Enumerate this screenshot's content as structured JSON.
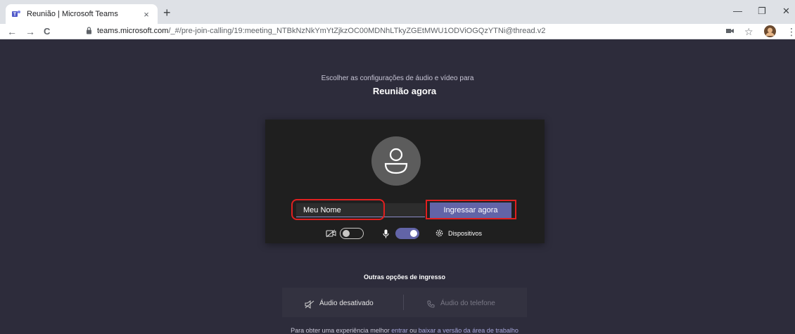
{
  "browser": {
    "tab_title": "Reunião | Microsoft Teams",
    "tab_close": "×",
    "new_tab": "+",
    "url_host": "teams.microsoft.com",
    "url_path": "/_#/pre-join-calling/19:meeting_NTBkNzNkYmYtZjkzOC00MDNhLTkyZGEtMWU1ODViOGQzYTNi@thread.v2",
    "back": "←",
    "forward": "→",
    "reload": "C",
    "minimize": "—",
    "restore": "❐",
    "close": "✕",
    "bookmark_star": "☆",
    "menu": "⋮"
  },
  "prejoin": {
    "subtitle": "Escolher as configurações de áudio e vídeo para",
    "meeting_title": "Reunião agora",
    "name_value": "Meu Nome",
    "join_label": "Ingressar agora",
    "devices_label": "Dispositivos",
    "camera_on": false,
    "mic_on": true
  },
  "other_options": {
    "title": "Outras opções de ingresso",
    "audio_off_label": "Áudio desativado",
    "phone_audio_label": "Áudio do telefone"
  },
  "footer": {
    "prefix": "Para obter uma experiência melhor ",
    "link_enter": "entrar",
    "or": " ou ",
    "link_download": "baixar a versão da área de trabalho"
  },
  "colors": {
    "accent": "#6264a7",
    "highlight": "#e02020",
    "background": "#2d2c3b",
    "card": "#1f1f1f"
  }
}
